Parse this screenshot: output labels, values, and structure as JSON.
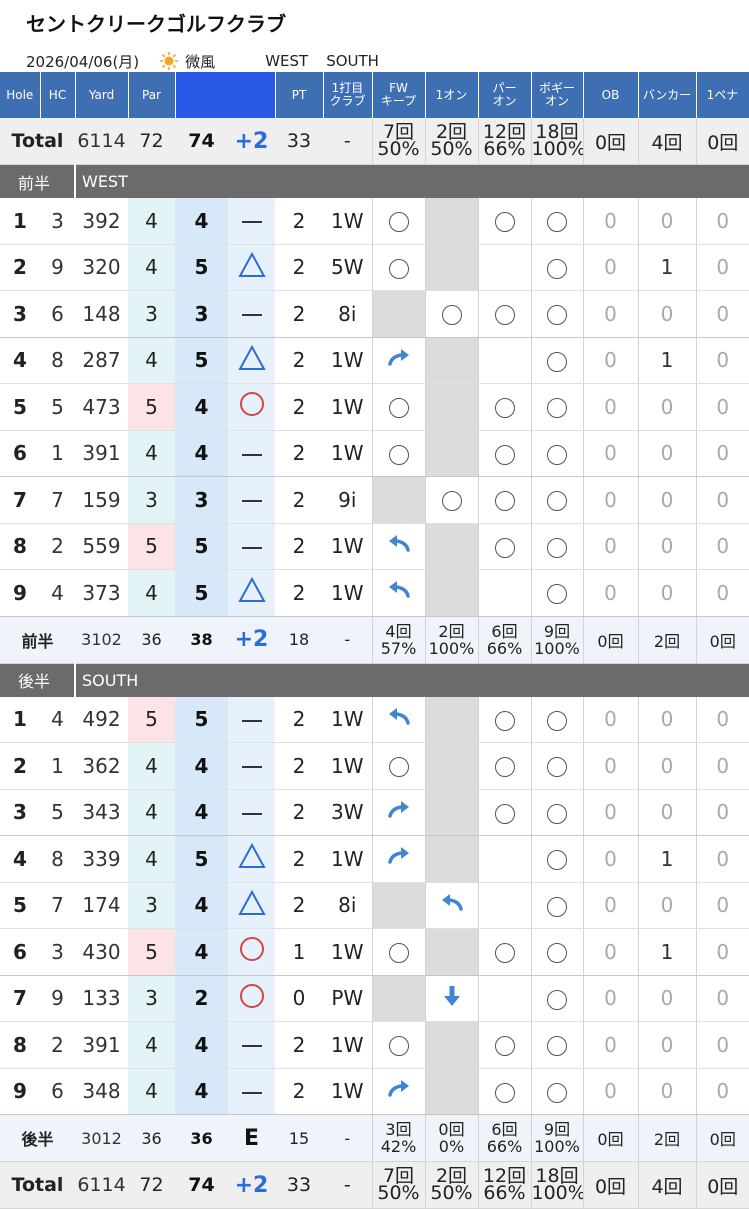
{
  "club_name": "セントクリークゴルフクラブ",
  "date": "2026/04/06(月)",
  "weather_icon": "sun-icon",
  "wind": "微風",
  "course_front": "WEST",
  "course_back": "SOUTH",
  "columns": [
    "Hole",
    "HC",
    "Yard",
    "Par",
    "",
    "PT",
    "1打目\nクラブ",
    "FW\nキープ",
    "1オン",
    "パー\nオン",
    "ボギー\nオン",
    "OB",
    "バンカー",
    "1ペナ"
  ],
  "total": {
    "label": "Total",
    "yard": "6114",
    "par": "72",
    "strokes": "74",
    "diff": "+2",
    "pt": "33",
    "club": "-",
    "fw": [
      "7回",
      "50%"
    ],
    "one_on": [
      "2回",
      "50%"
    ],
    "par_on": [
      "12回",
      "66%"
    ],
    "bogey_on": [
      "18回",
      "100%"
    ],
    "ob": "0回",
    "bunker": "4回",
    "pena": "0回"
  },
  "front": {
    "label": "前半",
    "course": "WEST",
    "holes": [
      {
        "no": "1",
        "hc": "3",
        "yard": "392",
        "par": "4",
        "strokes": "4",
        "mark": "dash",
        "pt": "2",
        "club": "1W",
        "fw": "circle",
        "one_on": "grey",
        "par_on": "circle",
        "bogey_on": "circle",
        "ob": "0",
        "bunker": "0",
        "pena": "0"
      },
      {
        "no": "2",
        "hc": "9",
        "yard": "320",
        "par": "4",
        "strokes": "5",
        "mark": "triangle",
        "pt": "2",
        "club": "5W",
        "fw": "circle",
        "one_on": "grey",
        "par_on": "",
        "bogey_on": "circle",
        "ob": "0",
        "bunker": "1",
        "pena": "0"
      },
      {
        "no": "3",
        "hc": "6",
        "yard": "148",
        "par": "3",
        "strokes": "3",
        "mark": "dash",
        "pt": "2",
        "club": "8i",
        "fw": "grey",
        "one_on": "circle",
        "par_on": "circle",
        "bogey_on": "circle",
        "ob": "0",
        "bunker": "0",
        "pena": "0"
      },
      {
        "no": "4",
        "hc": "8",
        "yard": "287",
        "par": "4",
        "strokes": "5",
        "mark": "triangle",
        "pt": "2",
        "club": "1W",
        "fw": "right",
        "one_on": "grey",
        "par_on": "",
        "bogey_on": "circle",
        "ob": "0",
        "bunker": "1",
        "pena": "0"
      },
      {
        "no": "5",
        "hc": "5",
        "yard": "473",
        "par": "5",
        "strokes": "4",
        "mark": "ocircle",
        "pt": "2",
        "club": "1W",
        "fw": "circle",
        "one_on": "grey",
        "par_on": "circle",
        "bogey_on": "circle",
        "ob": "0",
        "bunker": "0",
        "pena": "0"
      },
      {
        "no": "6",
        "hc": "1",
        "yard": "391",
        "par": "4",
        "strokes": "4",
        "mark": "dash",
        "pt": "2",
        "club": "1W",
        "fw": "circle",
        "one_on": "grey",
        "par_on": "circle",
        "bogey_on": "circle",
        "ob": "0",
        "bunker": "0",
        "pena": "0"
      },
      {
        "no": "7",
        "hc": "7",
        "yard": "159",
        "par": "3",
        "strokes": "3",
        "mark": "dash",
        "pt": "2",
        "club": "9i",
        "fw": "grey",
        "one_on": "circle",
        "par_on": "circle",
        "bogey_on": "circle",
        "ob": "0",
        "bunker": "0",
        "pena": "0"
      },
      {
        "no": "8",
        "hc": "2",
        "yard": "559",
        "par": "5",
        "strokes": "5",
        "mark": "dash",
        "pt": "2",
        "club": "1W",
        "fw": "left",
        "one_on": "grey",
        "par_on": "circle",
        "bogey_on": "circle",
        "ob": "0",
        "bunker": "0",
        "pena": "0"
      },
      {
        "no": "9",
        "hc": "4",
        "yard": "373",
        "par": "4",
        "strokes": "5",
        "mark": "triangle",
        "pt": "2",
        "club": "1W",
        "fw": "left",
        "one_on": "grey",
        "par_on": "",
        "bogey_on": "circle",
        "ob": "0",
        "bunker": "0",
        "pena": "0"
      }
    ],
    "sub": {
      "label": "前半",
      "yard": "3102",
      "par": "36",
      "strokes": "38",
      "diff": "+2",
      "pt": "18",
      "club": "-",
      "fw": [
        "4回",
        "57%"
      ],
      "one_on": [
        "2回",
        "100%"
      ],
      "par_on": [
        "6回",
        "66%"
      ],
      "bogey_on": [
        "9回",
        "100%"
      ],
      "ob": "0回",
      "bunker": "2回",
      "pena": "0回"
    }
  },
  "back": {
    "label": "後半",
    "course": "SOUTH",
    "holes": [
      {
        "no": "1",
        "hc": "4",
        "yard": "492",
        "par": "5",
        "strokes": "5",
        "mark": "dash",
        "pt": "2",
        "club": "1W",
        "fw": "left",
        "one_on": "grey",
        "par_on": "circle",
        "bogey_on": "circle",
        "ob": "0",
        "bunker": "0",
        "pena": "0"
      },
      {
        "no": "2",
        "hc": "1",
        "yard": "362",
        "par": "4",
        "strokes": "4",
        "mark": "dash",
        "pt": "2",
        "club": "1W",
        "fw": "circle",
        "one_on": "grey",
        "par_on": "circle",
        "bogey_on": "circle",
        "ob": "0",
        "bunker": "0",
        "pena": "0"
      },
      {
        "no": "3",
        "hc": "5",
        "yard": "343",
        "par": "4",
        "strokes": "4",
        "mark": "dash",
        "pt": "2",
        "club": "3W",
        "fw": "right",
        "one_on": "grey",
        "par_on": "circle",
        "bogey_on": "circle",
        "ob": "0",
        "bunker": "0",
        "pena": "0"
      },
      {
        "no": "4",
        "hc": "8",
        "yard": "339",
        "par": "4",
        "strokes": "5",
        "mark": "triangle",
        "pt": "2",
        "club": "1W",
        "fw": "right",
        "one_on": "grey",
        "par_on": "",
        "bogey_on": "circle",
        "ob": "0",
        "bunker": "1",
        "pena": "0"
      },
      {
        "no": "5",
        "hc": "7",
        "yard": "174",
        "par": "3",
        "strokes": "4",
        "mark": "triangle",
        "pt": "2",
        "club": "8i",
        "fw": "grey",
        "one_on": "left",
        "par_on": "",
        "bogey_on": "circle",
        "ob": "0",
        "bunker": "0",
        "pena": "0"
      },
      {
        "no": "6",
        "hc": "3",
        "yard": "430",
        "par": "5",
        "strokes": "4",
        "mark": "ocircle",
        "pt": "1",
        "club": "1W",
        "fw": "circle",
        "one_on": "grey",
        "par_on": "circle",
        "bogey_on": "circle",
        "ob": "0",
        "bunker": "1",
        "pena": "0"
      },
      {
        "no": "7",
        "hc": "9",
        "yard": "133",
        "par": "3",
        "strokes": "2",
        "mark": "ocircle",
        "pt": "0",
        "club": "PW",
        "fw": "grey",
        "one_on": "down",
        "par_on": "",
        "bogey_on": "circle",
        "ob": "0",
        "bunker": "0",
        "pena": "0"
      },
      {
        "no": "8",
        "hc": "2",
        "yard": "391",
        "par": "4",
        "strokes": "4",
        "mark": "dash",
        "pt": "2",
        "club": "1W",
        "fw": "circle",
        "one_on": "grey",
        "par_on": "circle",
        "bogey_on": "circle",
        "ob": "0",
        "bunker": "0",
        "pena": "0"
      },
      {
        "no": "9",
        "hc": "6",
        "yard": "348",
        "par": "4",
        "strokes": "4",
        "mark": "dash",
        "pt": "2",
        "club": "1W",
        "fw": "right",
        "one_on": "grey",
        "par_on": "circle",
        "bogey_on": "circle",
        "ob": "0",
        "bunker": "0",
        "pena": "0"
      }
    ],
    "sub": {
      "label": "後半",
      "yard": "3012",
      "par": "36",
      "strokes": "36",
      "diff": "E",
      "pt": "15",
      "club": "-",
      "fw": [
        "3回",
        "42%"
      ],
      "one_on": [
        "0回",
        "0%"
      ],
      "par_on": [
        "6回",
        "66%"
      ],
      "bogey_on": [
        "9回",
        "100%"
      ],
      "ob": "0回",
      "bunker": "2回",
      "pena": "0回"
    }
  }
}
